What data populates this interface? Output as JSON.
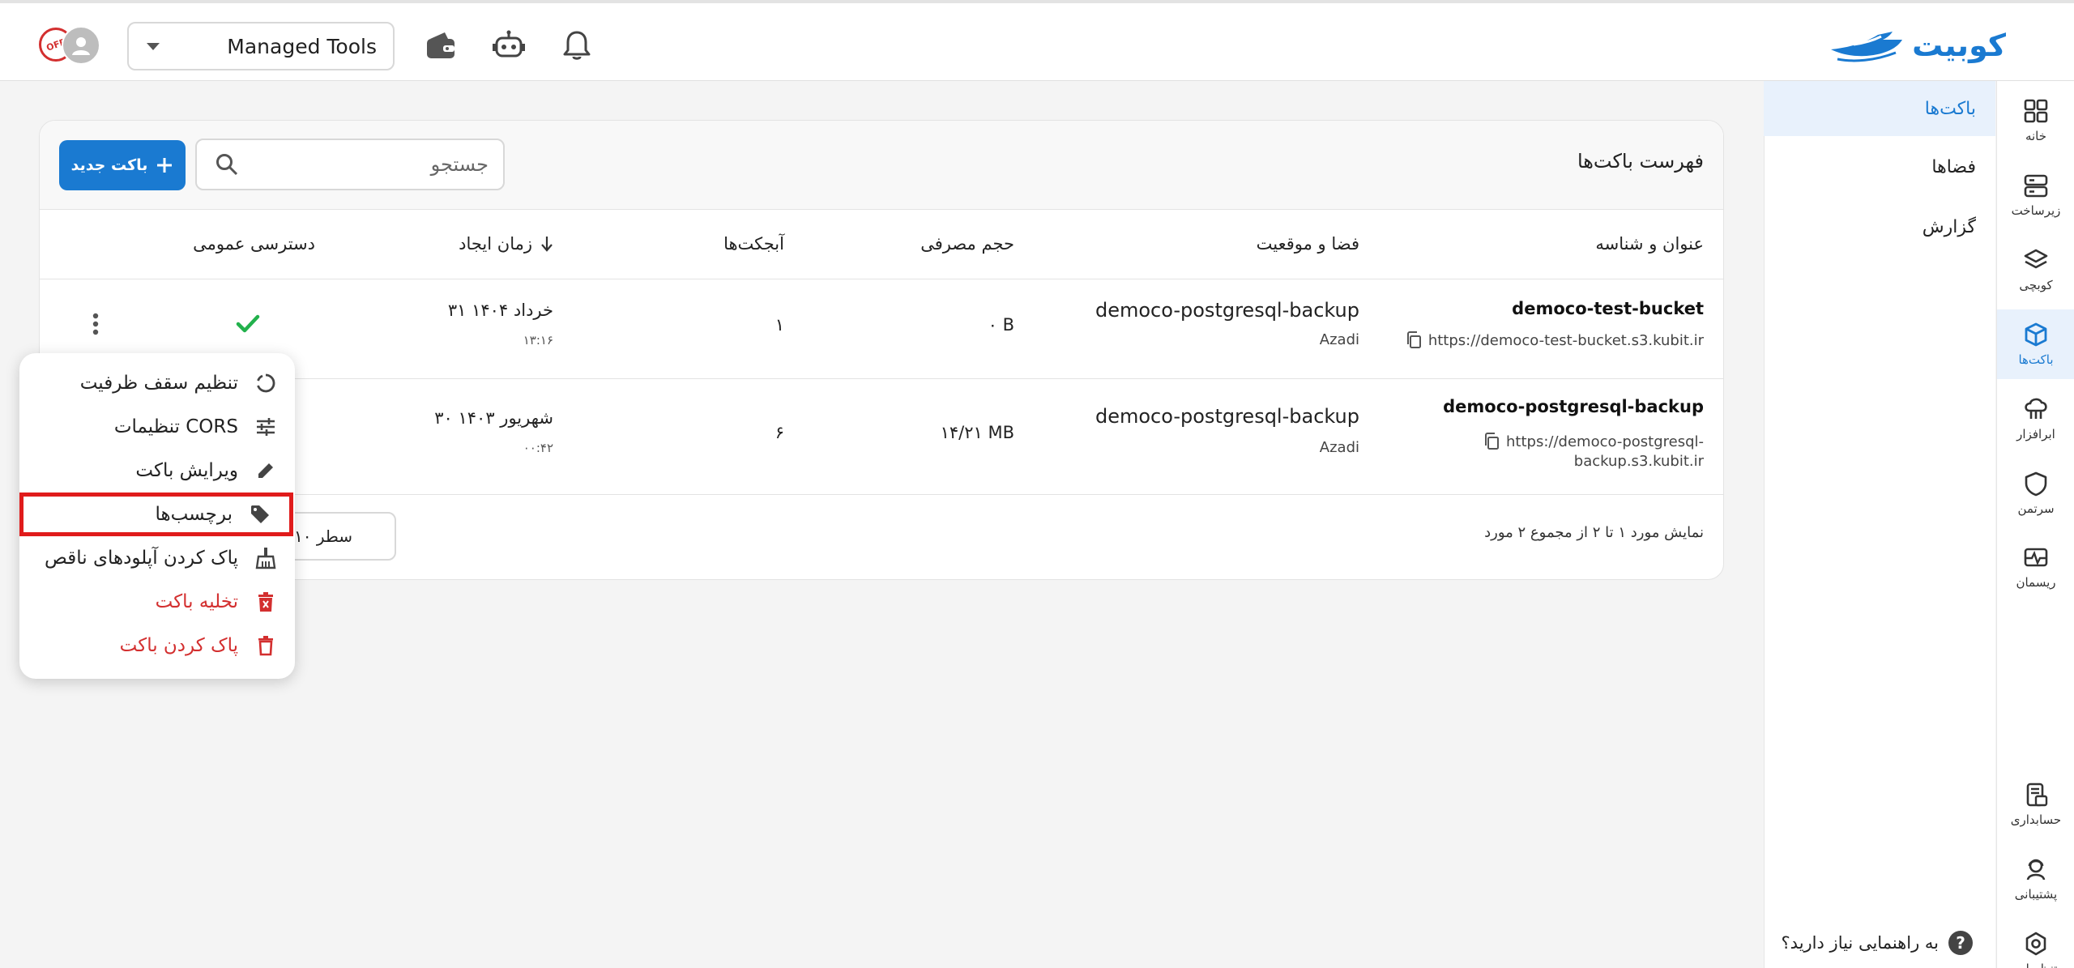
{
  "brand": {
    "logo_text": "کوبیت",
    "color": "#1a7ad1"
  },
  "topbar": {
    "org_selector_value": "Managed Tools",
    "avatar_badge_text": "OFF",
    "icons": [
      "wallet-icon",
      "robot-icon",
      "bell-icon"
    ]
  },
  "rail": {
    "items": [
      {
        "label": "خانه",
        "icon": "grid-icon"
      },
      {
        "label": "زیرساخت",
        "icon": "server-icon"
      },
      {
        "label": "کوبچی",
        "icon": "layers-icon"
      },
      {
        "label": "باکت‌ها",
        "icon": "box-icon",
        "active": true
      },
      {
        "label": "ابرافزار",
        "icon": "cloud-software-icon"
      },
      {
        "label": "سرتمن",
        "icon": "shield-icon"
      },
      {
        "label": "ریسمان",
        "icon": "monitor-icon"
      },
      {
        "label": "حسابداری",
        "icon": "accounting-icon"
      },
      {
        "label": "پشتیبانی",
        "icon": "support-icon"
      },
      {
        "label": "تنظیمات",
        "icon": "settings-icon"
      }
    ]
  },
  "subnav": {
    "items": [
      {
        "label": "باکت‌ها",
        "active": true
      },
      {
        "label": "فضاها"
      },
      {
        "label": "گزارش"
      }
    ],
    "help_label": "به راهنمایی نیاز دارید؟",
    "help_icon_text": "?"
  },
  "card": {
    "title": "فهرست باکت‌ها",
    "new_button_label": "باکت جدید",
    "search_placeholder": "جستجو",
    "columns": {
      "name": "عنوان و شناسه",
      "location": "فضا و موقعیت",
      "size": "حجم مصرفی",
      "objects": "آبجکت‌ها",
      "created": "زمان ایجاد",
      "public": "دسترسی عمومی"
    },
    "rows": [
      {
        "name": "democo-test-bucket",
        "url_line1": "https://democo-test-bucket.s3.kubit.ir",
        "url_line2": "",
        "space": "democo-postgresql-backup",
        "region": "Azadi",
        "size": "۰ B",
        "objects": "۱",
        "date": "۳۱ خرداد ۱۴۰۴",
        "time": "۱۳:۱۶",
        "public_access": true
      },
      {
        "name": "democo-postgresql-backup",
        "url_line1": "https://democo-postgresql-",
        "url_line2": "backup.s3.kubit.ir",
        "space": "democo-postgresql-backup",
        "region": "Azadi",
        "size": "۱۴/۲۱ MB",
        "objects": "۶",
        "date": "۳۰ شهریور ۱۴۰۳",
        "time": "۰۰:۴۲",
        "public_access": false
      }
    ],
    "pagination_text": "نمایش مورد ۱ تا ۲ از مجموع ۲ مورد",
    "per_page_value": "۱۰ سطر"
  },
  "context_menu": {
    "items": [
      {
        "label": "تنظیم سقف ظرفیت",
        "icon": "quota-icon"
      },
      {
        "label": "تنظیمات CORS",
        "icon": "sliders-icon"
      },
      {
        "label": "ویرایش باکت",
        "icon": "pencil-icon"
      },
      {
        "label": "برچسب‌ها",
        "icon": "tag-icon",
        "highlighted": true
      },
      {
        "label": "پاک کردن آپلودهای ناقص",
        "icon": "broom-icon"
      },
      {
        "label": "تخلیه باکت",
        "icon": "empty-bucket-icon",
        "danger": true
      },
      {
        "label": "پاک کردن باکت",
        "icon": "trash-icon",
        "danger": true
      }
    ]
  },
  "colors": {
    "accent": "#1a7ad1",
    "danger": "#d32f2f",
    "success": "#22b14c",
    "highlight_border": "#e01b1b"
  }
}
